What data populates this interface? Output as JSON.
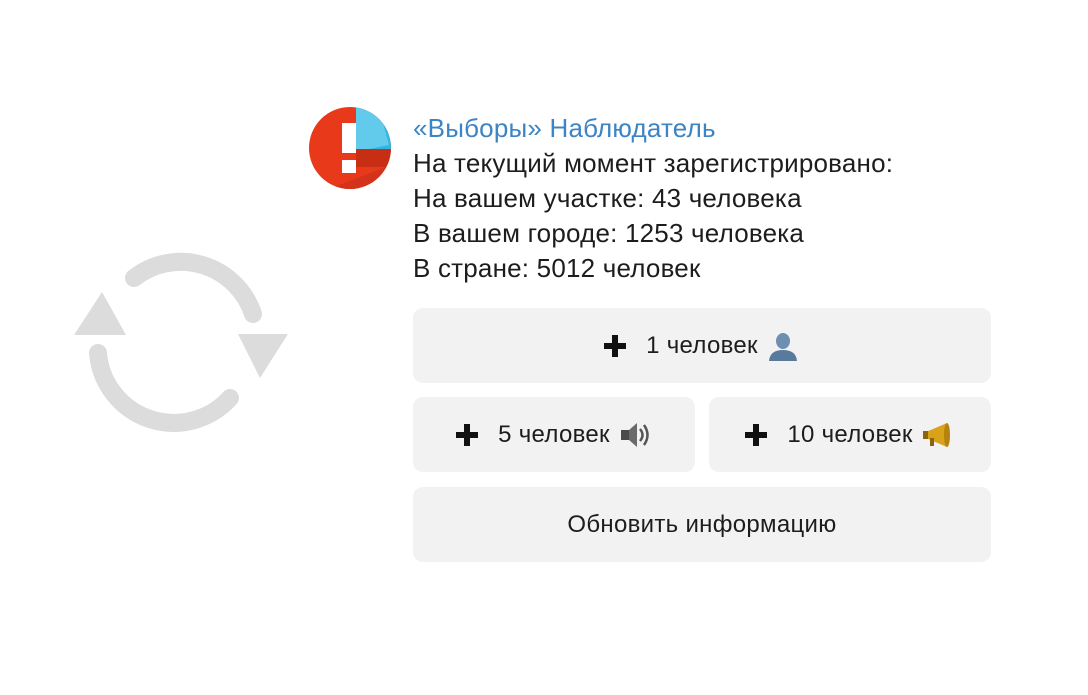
{
  "message": {
    "sender": "«Выборы» Наблюдатель",
    "lines": [
      "На текущий момент зарегистрировано:",
      "На вашем участке: 43 человека",
      "В вашем городе: 1253 человека",
      "В стране: 5012 человек"
    ]
  },
  "keyboard": {
    "add_1": {
      "label": "1 человек",
      "icon": "bust-silhouette-icon"
    },
    "add_5": {
      "label": "5 человек",
      "icon": "speaker-loud-icon"
    },
    "add_10": {
      "label": "10 человек",
      "icon": "megaphone-icon"
    },
    "refresh": {
      "label": "Обновить информацию"
    }
  },
  "icons": {
    "background": "refresh-icon",
    "avatar": "vybory-logo-icon"
  },
  "colors": {
    "sender": "#3d84c4",
    "button_bg": "#f2f2f2",
    "logo_red": "#e8391a",
    "logo_blue": "#2fb6e4",
    "refresh_gray": "#dcdcdc"
  }
}
